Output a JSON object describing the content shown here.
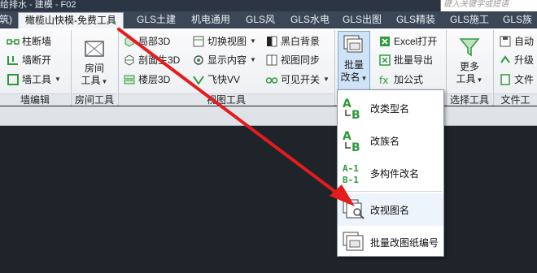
{
  "titlebar": {
    "title": "给排水 - 建模 - F02",
    "search_placeholder": "键入关键字或短语"
  },
  "tabs": [
    {
      "label": "筑)",
      "active": false
    },
    {
      "label": "橄榄山快模-免费工具",
      "active": true
    },
    {
      "label": "GLS土建",
      "active": false
    },
    {
      "label": "机电通用",
      "active": false
    },
    {
      "label": "GLS风",
      "active": false
    },
    {
      "label": "GLS水电",
      "active": false
    },
    {
      "label": "GLS出图",
      "active": false
    },
    {
      "label": "GLS精装",
      "active": false
    },
    {
      "label": "GLS施工",
      "active": false
    },
    {
      "label": "GLS族",
      "active": false
    }
  ],
  "ribbon": {
    "wall_edit": {
      "items": [
        "柱断墙",
        "墙断开",
        "墙工具"
      ],
      "label": "墙编辑"
    },
    "room_tools": {
      "big_button": [
        "房间",
        "工具"
      ],
      "label": "房间工具"
    },
    "view_tools": {
      "col1": [
        "局部3D",
        "剖面生3D",
        "楼层3D"
      ],
      "col2": [
        "切换视图",
        "显示内容",
        "飞快VV"
      ],
      "col3": [
        "黑白背景",
        "视图同步",
        "可见开关"
      ],
      "label": "视图工具"
    },
    "batch_rename": {
      "big_button": [
        "批量",
        "改名"
      ]
    },
    "excel": {
      "items": [
        "Excel打开",
        "批量导出",
        "加公式"
      ]
    },
    "select_tools": {
      "big_button": [
        "更多",
        "工具"
      ],
      "label": "选择工具"
    },
    "file_tools": {
      "items": [
        "自动",
        "升级",
        "文件"
      ],
      "label": "文件工"
    }
  },
  "menu": {
    "items": [
      "改类型名",
      "改族名",
      "多构件改名",
      "改视图名",
      "批量改图纸编号"
    ]
  },
  "colors": {
    "accent": "#e31c1c",
    "green_icon": "#2e9a3c",
    "tab_bar": "#3a4757",
    "canvas": "#1f242b"
  }
}
